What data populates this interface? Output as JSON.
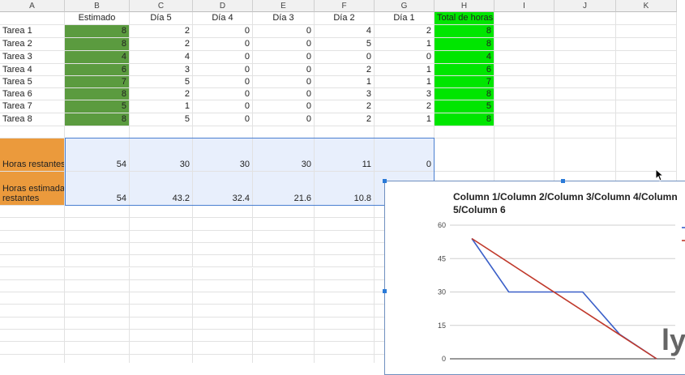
{
  "columns": [
    "A",
    "B",
    "C",
    "D",
    "E",
    "F",
    "G",
    "H",
    "I",
    "J",
    "K"
  ],
  "header_row": [
    "",
    "Estimado",
    "Día 5",
    "Día 4",
    "Día 3",
    "Día 2",
    "Día 1",
    "Total de horas"
  ],
  "tasks": [
    [
      "Tarea 1",
      "8",
      "2",
      "0",
      "0",
      "4",
      "2",
      "8"
    ],
    [
      "Tarea 2",
      "8",
      "2",
      "0",
      "0",
      "5",
      "1",
      "8"
    ],
    [
      "Tarea 3",
      "4",
      "4",
      "0",
      "0",
      "0",
      "0",
      "4"
    ],
    [
      "Tarea 4",
      "6",
      "3",
      "0",
      "0",
      "2",
      "1",
      "6"
    ],
    [
      "Tarea 5",
      "7",
      "5",
      "0",
      "0",
      "1",
      "1",
      "7"
    ],
    [
      "Tarea 6",
      "8",
      "2",
      "0",
      "0",
      "3",
      "3",
      "8"
    ],
    [
      "Tarea 7",
      "5",
      "1",
      "0",
      "0",
      "2",
      "2",
      "5"
    ],
    [
      "Tarea 8",
      "8",
      "5",
      "0",
      "0",
      "2",
      "1",
      "8"
    ]
  ],
  "summary": {
    "remaining_label": "Horas restantes",
    "remaining_values": [
      "54",
      "30",
      "30",
      "30",
      "11",
      "0"
    ],
    "estimated_label_line1": "Horas estimadas",
    "estimated_label_line2": "restantes",
    "estimated_values": [
      "54",
      "43.2",
      "32.4",
      "21.6",
      "10.8"
    ]
  },
  "colors": {
    "estimate_fill": "#5b9b3f",
    "total_fill": "#00e600",
    "label_fill": "#eb9a3c",
    "summary_fill": "#e8effc",
    "series_actual": "#3a5fc8",
    "series_ideal": "#c0392b"
  },
  "chart": {
    "title_line1": "Column 1/Column 2/Column 3/Column 4/Column",
    "title_line2": "5/Column 6"
  },
  "chart_data": {
    "type": "line",
    "title": "Column 1/Column 2/Column 3/Column 4/Column 5/Column 6",
    "x": [
      1,
      2,
      3,
      4,
      5,
      6
    ],
    "series": [
      {
        "values": [
          54,
          30,
          30,
          30,
          11,
          0
        ]
      },
      {
        "values": [
          54,
          43.2,
          32.4,
          21.6,
          10.8,
          0
        ]
      }
    ],
    "yticks": [
      "60",
      "45",
      "30",
      "15",
      "0"
    ],
    "ylim": [
      0,
      60
    ],
    "grid": true,
    "legend": "right"
  },
  "watermark": "ly"
}
